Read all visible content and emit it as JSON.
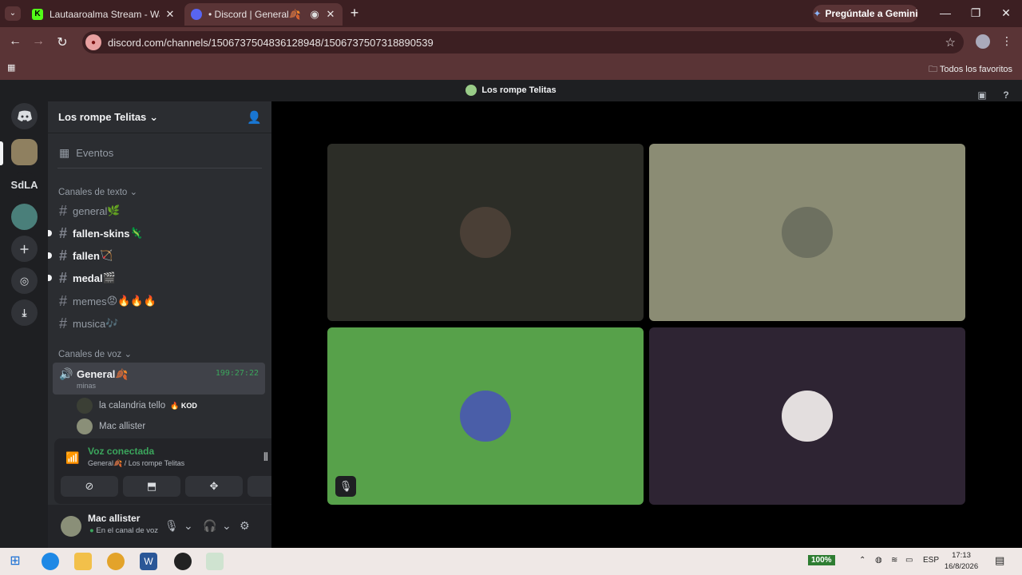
{
  "browser": {
    "tabs": [
      {
        "title": "Lautaaroalma Stream - Watch",
        "active": false
      },
      {
        "title": "• Discord | General🍂 | Los",
        "active": true
      }
    ],
    "gemini_label": "Pregúntale a Gemini",
    "url": "discord.com/channels/1506737504836128948/1506737507318890539",
    "bookmarks_label": "Todos los favoritos"
  },
  "discord": {
    "window_title": "Los rompe Telitas",
    "guild_labels": {
      "sdla": "SdLA"
    },
    "server_name": "Los rompe Telitas",
    "events_label": "Eventos",
    "text_category": "Canales de texto",
    "text_channels": [
      {
        "name": "general",
        "emoji": "🌿",
        "unread": false
      },
      {
        "name": "fallen-skins",
        "emoji": "🦎",
        "unread": true
      },
      {
        "name": "fallen",
        "emoji": "🏹",
        "unread": true
      },
      {
        "name": "medal",
        "emoji": "🎬",
        "unread": true
      },
      {
        "name": "memes",
        "emoji": "😡🔥🔥🔥",
        "unread": false
      },
      {
        "name": "musica",
        "emoji": "🎶",
        "unread": false
      }
    ],
    "voice_category": "Canales de voz",
    "voice_channel": {
      "name": "General🍂",
      "timer": "199:27:22",
      "status": "minas"
    },
    "voice_users": [
      {
        "name": "la calandria tello",
        "tag": "🔥 KOD"
      },
      {
        "name": "Mac allister",
        "tag": ""
      }
    ],
    "voice_panel": {
      "title": "Voz conectada",
      "subtitle": "General🍂 / Los rompe Telitas"
    },
    "user": {
      "name": "Mac allister",
      "status": "En el canal de voz"
    },
    "colors": {
      "connected_green": "#3ba55c",
      "tile_speaking": "#57a14a"
    }
  },
  "taskbar": {
    "battery": "100%",
    "lang": "ESP",
    "time": "17:13",
    "date": "16/8/2026"
  }
}
